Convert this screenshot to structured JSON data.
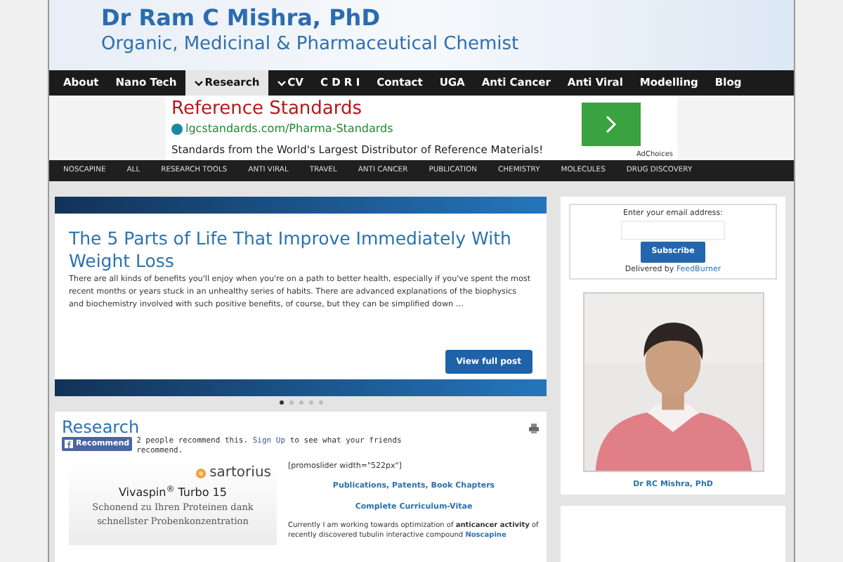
{
  "header": {
    "title": "Dr Ram C Mishra, PhD",
    "subtitle": "Organic, Medicinal & Pharmaceutical Chemist"
  },
  "nav": [
    {
      "label": "About",
      "selected": false,
      "dropdown": false
    },
    {
      "label": "Nano Tech",
      "selected": false,
      "dropdown": false
    },
    {
      "label": "Research",
      "selected": true,
      "dropdown": true
    },
    {
      "label": "CV",
      "selected": false,
      "dropdown": true
    },
    {
      "label": "C D R I",
      "selected": false,
      "dropdown": false
    },
    {
      "label": "Contact",
      "selected": false,
      "dropdown": false
    },
    {
      "label": "UGA",
      "selected": false,
      "dropdown": false
    },
    {
      "label": "Anti Cancer",
      "selected": false,
      "dropdown": false
    },
    {
      "label": "Anti Viral",
      "selected": false,
      "dropdown": false
    },
    {
      "label": "Modelling",
      "selected": false,
      "dropdown": false
    },
    {
      "label": "Blog",
      "selected": false,
      "dropdown": false
    }
  ],
  "top_ad": {
    "headline": "Reference Standards",
    "url": "lgcstandards.com/Pharma-Standards",
    "text": "Standards from the World's Largest Distributor of Reference Materials!",
    "badge": "AdChoices"
  },
  "categories": [
    "NOSCAPINE",
    "ALL",
    "RESEARCH TOOLS",
    "ANTI VIRAL",
    "TRAVEL",
    "ANTI CANCER",
    "PUBLICATION",
    "CHEMISTRY",
    "MOLECULES",
    "DRUG DISCOVERY"
  ],
  "slider": {
    "title": "The 5 Parts of Life That Improve Immediately With Weight Loss",
    "excerpt": "There are all kinds of benefits you'll enjoy when you're on a path to better health, especially if you've spent the most recent months or years stuck in an unhealthy series of habits. There are advanced explanations of the biophysics and biochemistry involved with such positive benefits, of course, but they can be simplified down …",
    "button": "View full post",
    "dots": [
      {
        "selected": true
      },
      {
        "selected": false
      },
      {
        "selected": false
      },
      {
        "selected": false
      },
      {
        "selected": false
      }
    ]
  },
  "research": {
    "title": "Research",
    "recommend_button": "Recommend",
    "recommend_text": "2 people recommend this.",
    "signup_link": "Sign Up",
    "recommend_rest": "to see what your friends recommend.",
    "ad": {
      "brand": "sartorius",
      "product": "Vivaspin$^{®}$ Turbo 15",
      "line1": "Schonend zu Ihren Proteinen dank",
      "line2": "schnellster Probenkonzentration"
    },
    "shortcode": "[promoslider width=\"522px\"]",
    "links": [
      "Publications, Patents, Book Chapters",
      "Complete Curriculum-Vitae"
    ],
    "paragraph": "Currently I am working towards optimization of **anticancer activity** of recently discovered tubulin interactive compound",
    "paragraph_link": "Noscapine"
  },
  "sidebar": {
    "email_label": "Enter your email address:",
    "subscribe": "Subscribe",
    "delivered_by": "Delivered by",
    "feedburner": "FeedBurner",
    "caption": "Dr RC Mishra, PhD"
  }
}
